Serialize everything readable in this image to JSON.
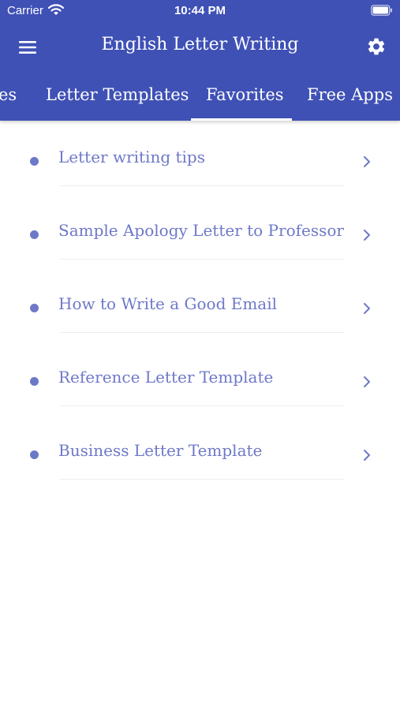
{
  "status_bar": {
    "carrier": "Carrier",
    "time": "10:44 PM"
  },
  "header": {
    "title": "English Letter Writing",
    "left_icon": "menu-icon",
    "right_icon": "gear-icon",
    "background": "#3f51b5"
  },
  "tabs": [
    {
      "label": "es"
    },
    {
      "label": "Letter Templates"
    },
    {
      "label": "Favorites",
      "selected": true
    },
    {
      "label": "Free Apps"
    }
  ],
  "favorites": [
    {
      "label": "Letter writing tips"
    },
    {
      "label": "Sample Apology Letter to Professor"
    },
    {
      "label": "How to Write a Good Email"
    },
    {
      "label": "Reference Letter Template"
    },
    {
      "label": "Business Letter Template"
    }
  ],
  "colors": {
    "accent": "#6e78c8",
    "divider": "#eeeeee"
  }
}
